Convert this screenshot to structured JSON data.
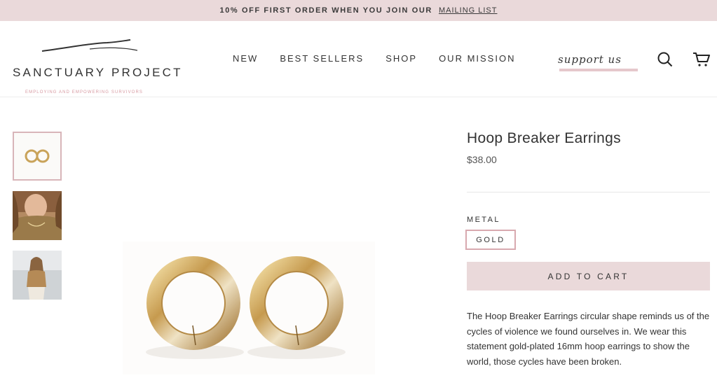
{
  "announcement": {
    "text": "10% OFF FIRST ORDER WHEN YOU JOIN OUR",
    "link": "MAILING LIST"
  },
  "brand": {
    "name": "SANCTUARY PROJECT",
    "tagline": "EMPLOYING AND EMPOWERING SURVIVORS"
  },
  "nav": {
    "items": [
      "NEW",
      "BEST SELLERS",
      "SHOP",
      "OUR MISSION"
    ]
  },
  "header": {
    "support_label": "support us",
    "search_icon": "search-icon",
    "cart_icon": "cart-icon"
  },
  "gallery": {
    "thumbnails": [
      "hoop-earrings-product",
      "model-wearing-necklace",
      "model-full-outfit"
    ],
    "active_index": 0
  },
  "product": {
    "title": "Hoop Breaker Earrings",
    "price": "$38.00",
    "option_label": "METAL",
    "option_selected": "GOLD",
    "add_to_cart": "ADD TO CART",
    "description": "The Hoop Breaker Earrings circular shape reminds us of the cycles of violence we found ourselves in. We wear this statement gold-plated 16mm hoop earrings to show the world, those cycles have been broken."
  },
  "colors": {
    "accent": "#ead9da",
    "swatch_border": "#d8a9af",
    "tagline": "#d79aa2",
    "gold": "#c9a35a"
  }
}
